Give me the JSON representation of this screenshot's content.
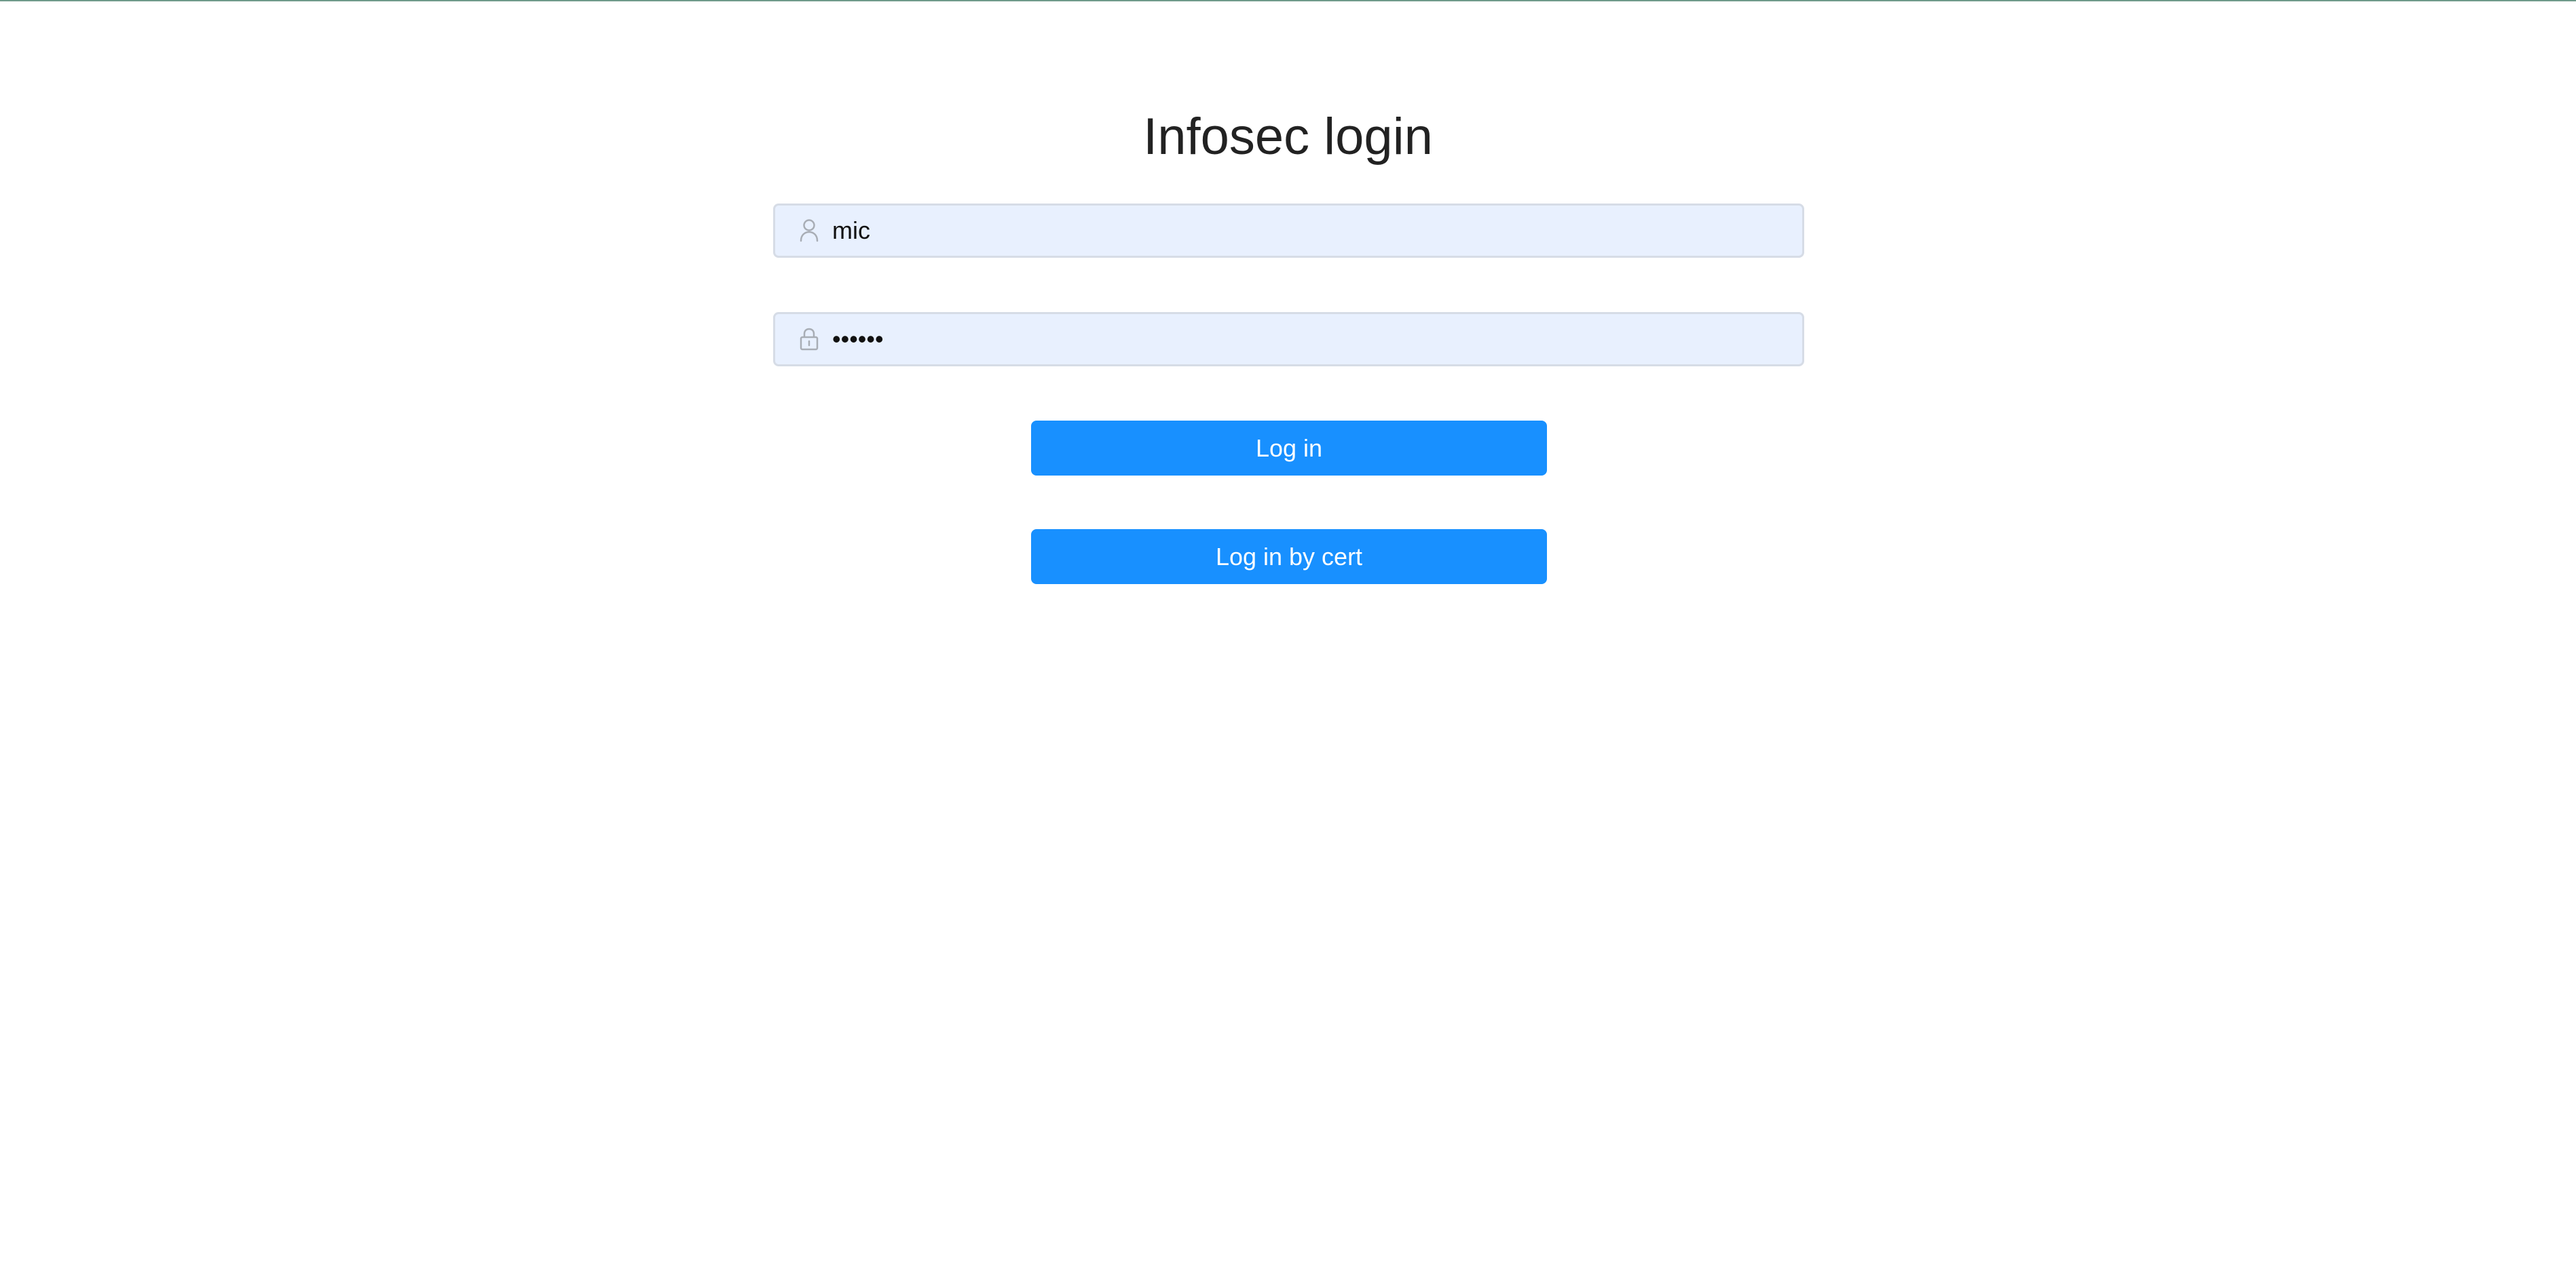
{
  "page": {
    "title": "Infosec login"
  },
  "form": {
    "username": {
      "value": "mic",
      "icon": "user-icon"
    },
    "password": {
      "value": "••••••",
      "icon": "lock-icon"
    },
    "login_button_label": "Log in",
    "cert_login_button_label": "Log in by cert"
  },
  "colors": {
    "accent": "#1890ff",
    "input_background": "#e8f0fe",
    "input_border": "#d6dce6",
    "title_text": "#222222"
  }
}
